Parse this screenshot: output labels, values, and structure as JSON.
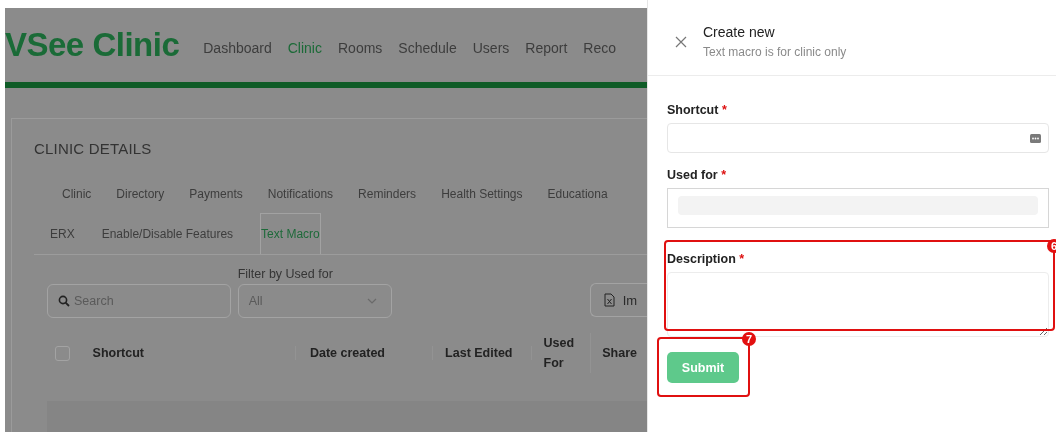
{
  "app": {
    "logo": "VSee Clinic",
    "nav": [
      {
        "label": "Dashboard",
        "selected": false
      },
      {
        "label": "Clinic",
        "selected": true
      },
      {
        "label": "Rooms",
        "selected": false
      },
      {
        "label": "Schedule",
        "selected": false
      },
      {
        "label": "Users",
        "selected": false
      },
      {
        "label": "Report",
        "selected": false
      },
      {
        "label": "Reco",
        "selected": false
      }
    ]
  },
  "page": {
    "title": "CLINIC DETAILS",
    "tab_rows": [
      [
        {
          "label": "Clinic",
          "selected": false
        },
        {
          "label": "Directory",
          "selected": false
        },
        {
          "label": "Payments",
          "selected": false
        },
        {
          "label": "Notifications",
          "selected": false
        },
        {
          "label": "Reminders",
          "selected": false
        },
        {
          "label": "Health Settings",
          "selected": false
        },
        {
          "label": "Educationa",
          "selected": false
        }
      ],
      [
        {
          "label": "ERX",
          "selected": false
        },
        {
          "label": "Enable/Disable Features",
          "selected": false
        },
        {
          "label": "Text Macro",
          "selected": true
        }
      ]
    ],
    "search": {
      "placeholder": "Search"
    },
    "filter": {
      "label": "Filter by Used for",
      "value": "All"
    },
    "import_button": "Im",
    "table": {
      "select_all": {
        "checked": false
      },
      "columns": [
        "Shortcut",
        "Date created",
        "Last Edited",
        "Used For",
        "Share"
      ]
    }
  },
  "drawer": {
    "title": "Create new",
    "subtitle": "Text macro is for clinic only",
    "fields": [
      {
        "kind": "text",
        "label": "Shortcut",
        "required_mark": "*"
      },
      {
        "kind": "select",
        "label": "Used for",
        "required_mark": "*"
      },
      {
        "kind": "textarea",
        "label": "Description",
        "required_mark": "*",
        "callout": "6"
      }
    ],
    "submit": {
      "label": "Submit",
      "disabled": true,
      "callout": "7"
    }
  }
}
